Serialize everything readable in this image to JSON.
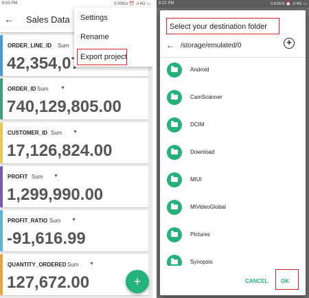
{
  "left": {
    "status": {
      "time": "8:03 PM",
      "right": "0.00K/s ⏰ .ıl 4G ▭"
    },
    "appbar": {
      "title": "Sales Data",
      "back_icon": "arrow-left-icon"
    },
    "cards": [
      {
        "name": "ORDER_LINE_ID",
        "agg": "Sum",
        "value": "42,354,07",
        "stripe": "#4a9bd1"
      },
      {
        "name": "ORDER_ID",
        "agg": "Sum",
        "value": "740,129,805.00",
        "stripe": "#3ba374"
      },
      {
        "name": "CUSTOMER_ID",
        "agg": "Sum",
        "value": "17,126,824.00",
        "stripe": "#e9c85a"
      },
      {
        "name": "PROFIT",
        "agg": "Sum",
        "value": "1,299,990.00",
        "stripe": "#7d5aa8"
      },
      {
        "name": "PROFIT_RATIO",
        "agg": "Sum",
        "value": "-91,616.99",
        "stripe": "#59b4d6"
      },
      {
        "name": "QUANTITY_ORDERED",
        "agg": "Sum",
        "value": "127,672.00",
        "stripe": "#e9a445"
      }
    ],
    "menu": {
      "items": [
        "Settings",
        "Rename",
        "Export project"
      ]
    },
    "fab": {
      "icon": "plus-icon",
      "label": "+"
    }
  },
  "right": {
    "status": {
      "time": "8:21 PM",
      "right": "0.61K/s ⏰ .ıl 4G ▭"
    },
    "dialog": {
      "title": "Select your destination folder",
      "path": "/storage/emulated/0",
      "back_icon": "arrow-left-icon",
      "add_icon": "add-circle-icon",
      "folders": [
        "Android",
        "CamScanner",
        "DCIM",
        "Download",
        "MIUI",
        "MiVideoGlobal",
        "Pictures",
        "Synopsis"
      ],
      "cancel": "CANCEL",
      "ok": "OK"
    }
  },
  "colors": {
    "accent": "#24b27a",
    "highlight": "#d9252a"
  }
}
